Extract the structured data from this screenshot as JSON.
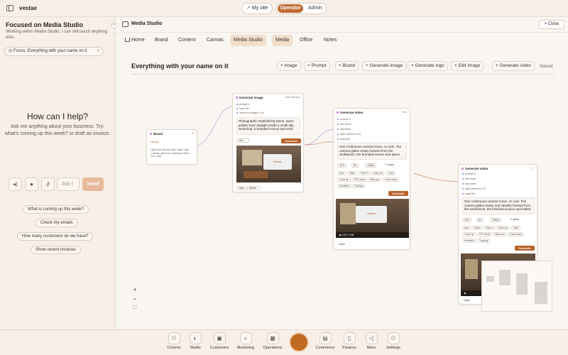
{
  "topbar": {
    "brand": "vestae",
    "my_site": "My site",
    "roles": [
      "Operator",
      "Admin"
    ]
  },
  "left": {
    "focus_title": "Focused on Media Studio",
    "focus_desc": "Working within Media Studio. I can still reach anything else.",
    "focus_chip": "Focus: Everything with your name on it",
    "help_title": "How can I help?",
    "help_sub": "Ask me anything about your business. Try: what's coming up this week? or draft an invoice.",
    "input_placeholder": "Ask t",
    "send_label": "Send",
    "suggestions": [
      "What is coming up this week?",
      "Check my emails",
      "How many customers do we have?",
      "Show recent invoices"
    ]
  },
  "main": {
    "title": "Media Studio",
    "close_label": "Close",
    "tabs": [
      "Home",
      "Brand",
      "Content",
      "Canvas",
      "Media Studio",
      "Media",
      "Office",
      "Notes"
    ],
    "page_title": "Everything with your name on it",
    "actions": [
      "+ Image",
      "+ Prompt",
      "+ Brand",
      "+ Generate image",
      "+ Generate logo",
      "+ Edit image",
      "+ Generate video"
    ],
    "saved": "Saved"
  },
  "nodes": {
    "brand": {
      "title": "Brand",
      "name": "vestae",
      "desc": "Light Hint, Breezy style bright, high contrast, generous spacing (0.5rem font, crisp"
    },
    "gen_image": {
      "title": "Generate image",
      "tag": "Nano Banana",
      "inputs": [
        "prompt in",
        "brand kit",
        "reference images 1/14"
      ],
      "prompt": "Photographic establishing frame, warm golden-hour daylight inside a small tidy workshop: a branded invoice and work",
      "ratio": "16:9",
      "generate": "Generate",
      "open": "Open",
      "refine": "Refine..."
    },
    "gen_video_1": {
      "title": "Generate video",
      "tag": "Veo",
      "inputs": [
        "prompt in",
        "first frame",
        "last frame",
        "style reference 0/3",
        "brand kit"
      ],
      "prompt": "One continuous camera move, no cuts. The camera glides slowly forward from the workbench, the branded invoice and apron",
      "options": [
        "16:9",
        "8s",
        "1080p",
        "audio"
      ],
      "chips": [
        "Auto",
        "Static",
        "Push in",
        "Dolly out",
        "Orbit",
        "Crane up",
        "FPV drone",
        "Whip pan",
        "Crash zoom",
        "Handheld",
        "Tracking"
      ],
      "generate": "Generate",
      "time": "0:00 / 0:08",
      "open": "Open"
    },
    "gen_video_2": {
      "title": "Generate video",
      "inputs": [
        "prompt in",
        "first frame",
        "last frame",
        "style reference 0/3",
        "brand kit"
      ],
      "prompt": "One continuous camera move, no cuts. The camera glides slowly and steadily forward from the workbench, the branded invoice and folded",
      "options": [
        "16:9",
        "8s",
        "1080p",
        "audio"
      ],
      "chips": [
        "Auto",
        "Static",
        "Push in",
        "Dolly out",
        "Orbit",
        "Crane up",
        "FPV drone",
        "Whip pan",
        "Crash zoom",
        "Handheld",
        "Tracking"
      ],
      "generate": "Generate",
      "open": "Open"
    },
    "van_label": "vestae"
  },
  "zoom": [
    "+",
    "−",
    "⛶"
  ],
  "dock": [
    {
      "label": "Comms",
      "icon": "users-icon"
    },
    {
      "label": "Studio",
      "icon": "palette-icon"
    },
    {
      "label": "Customers",
      "icon": "contacts-icon"
    },
    {
      "label": "Marketing",
      "icon": "search-icon"
    },
    {
      "label": "Operations",
      "icon": "calendar-icon"
    },
    {
      "label": "Commerce",
      "icon": "cart-icon"
    },
    {
      "label": "Finance",
      "icon": "document-icon"
    },
    {
      "label": "More",
      "icon": "megaphone-icon"
    },
    {
      "label": "Settings",
      "icon": "people-icon"
    }
  ],
  "colors": {
    "accent": "#c06a33",
    "background": "#f7efe8",
    "canvas": "#f9f5f1"
  }
}
